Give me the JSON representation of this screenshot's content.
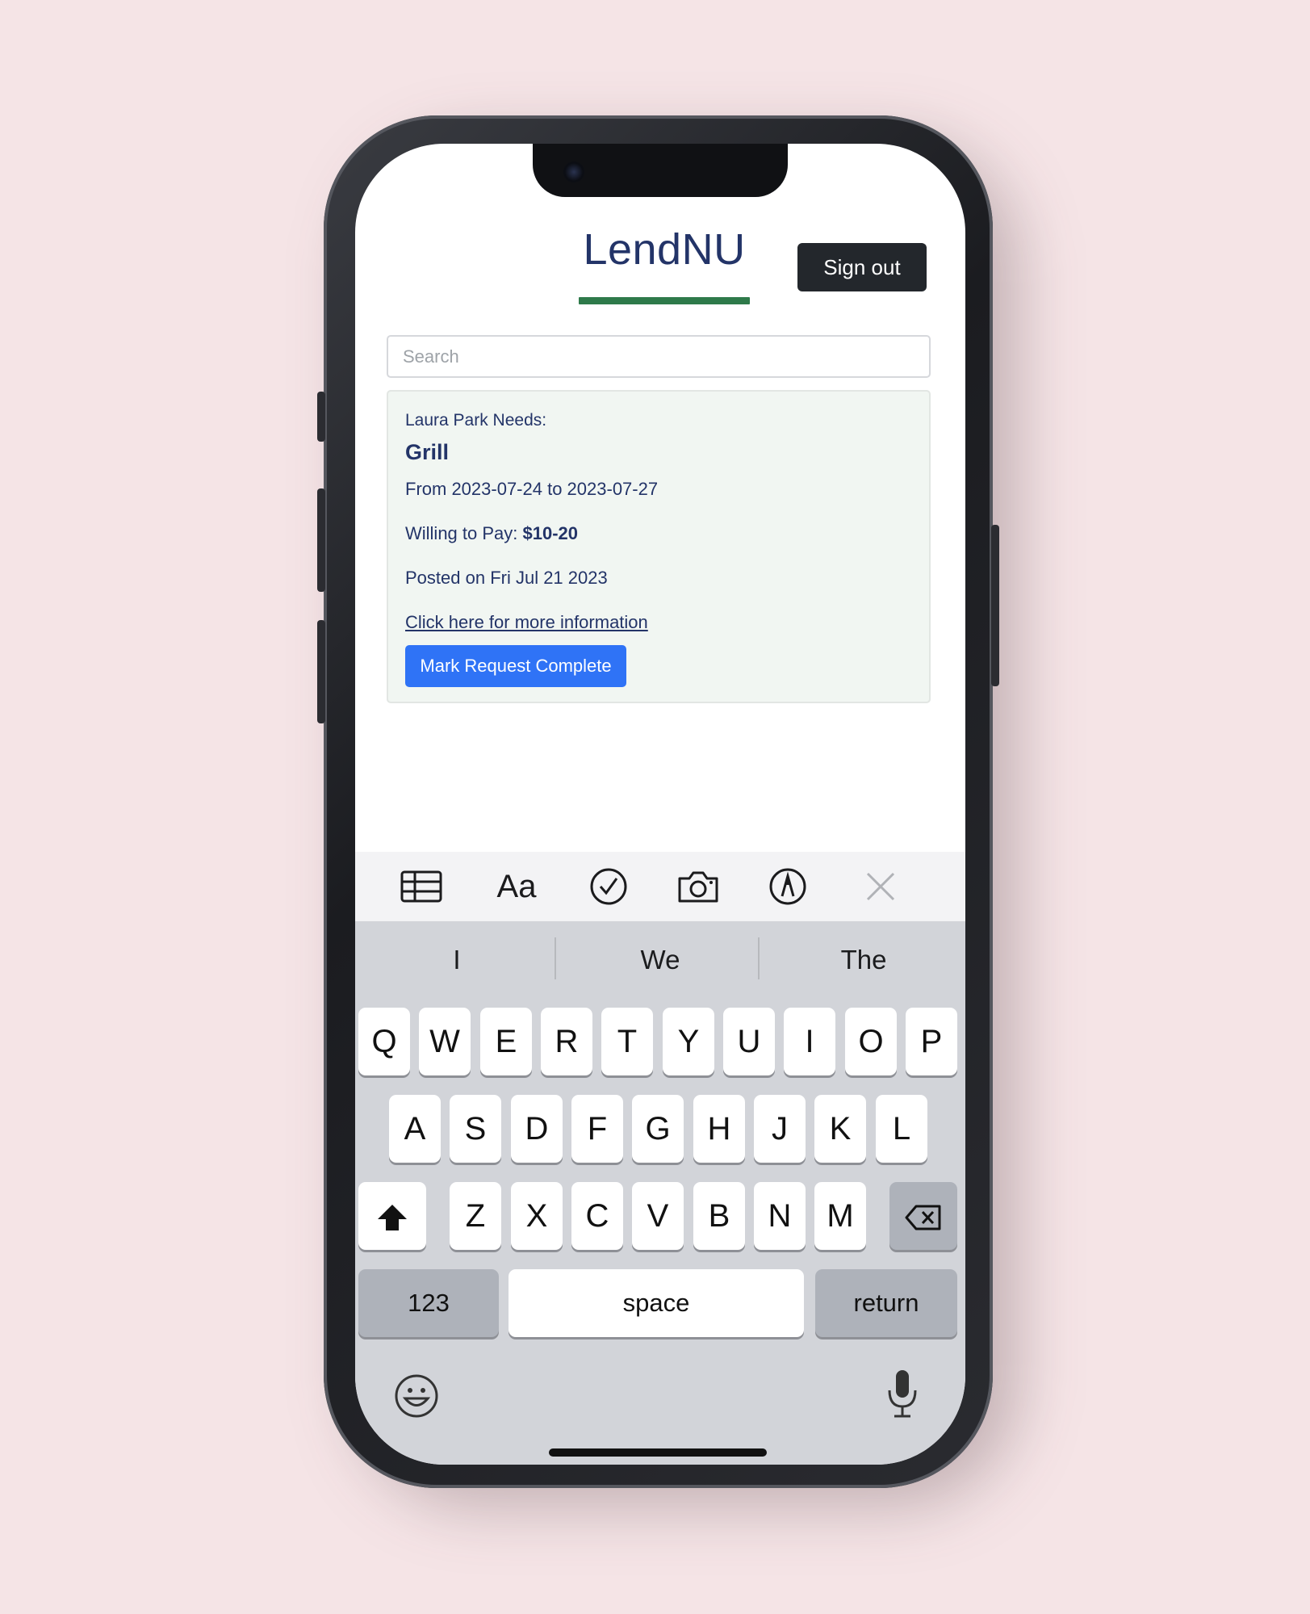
{
  "app": {
    "logo": "LendNU",
    "sign_out_label": "Sign out",
    "search_placeholder": "Search"
  },
  "request": {
    "who": "Laura Park Needs:",
    "item": "Grill",
    "dates": "From 2023-07-24 to 2023-07-27",
    "pay_label": "Willing to Pay:",
    "pay_value": "$10-20",
    "posted": "Posted on Fri Jul 21 2023",
    "info_link": "Click here for more information",
    "complete_button": "Mark Request Complete"
  },
  "keyboard": {
    "toolbar": [
      {
        "icon": "table-icon"
      },
      {
        "icon": "text-format-icon",
        "label": "Aa"
      },
      {
        "icon": "checklist-icon"
      },
      {
        "icon": "camera-icon"
      },
      {
        "icon": "markup-icon"
      },
      {
        "icon": "close-icon"
      }
    ],
    "suggestions": [
      "I",
      "We",
      "The"
    ],
    "row1": [
      "Q",
      "W",
      "E",
      "R",
      "T",
      "Y",
      "U",
      "I",
      "O",
      "P"
    ],
    "row2": [
      "A",
      "S",
      "D",
      "F",
      "G",
      "H",
      "J",
      "K",
      "L"
    ],
    "row3": [
      "Z",
      "X",
      "C",
      "V",
      "B",
      "N",
      "M"
    ],
    "numbers_label": "123",
    "space_label": "space",
    "return_label": "return"
  }
}
